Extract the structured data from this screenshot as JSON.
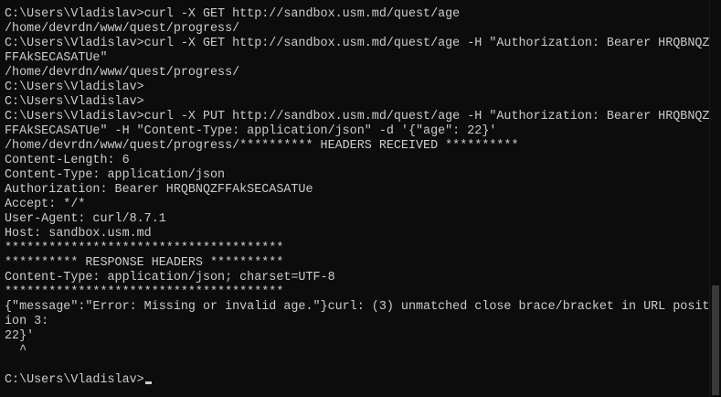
{
  "console": {
    "lines": [
      "C:\\Users\\Vladislav>curl -X GET http://sandbox.usm.md/quest/age",
      "/home/devrdn/www/quest/progress/",
      "C:\\Users\\Vladislav>curl -X GET http://sandbox.usm.md/quest/age -H \"Authorization: Bearer HRQBNQZ",
      "FFAkSECASATUe\"",
      "/home/devrdn/www/quest/progress/",
      "C:\\Users\\Vladislav>",
      "C:\\Users\\Vladislav>",
      "C:\\Users\\Vladislav>curl -X PUT http://sandbox.usm.md/quest/age -H \"Authorization: Bearer HRQBNQZ",
      "FFAkSECASATUe\" -H \"Content-Type: application/json\" -d '{\"age\": 22}'",
      "/home/devrdn/www/quest/progress/********** HEADERS RECEIVED **********",
      "Content-Length: 6",
      "Content-Type: application/json",
      "Authorization: Bearer HRQBNQZFFAkSECASATUe",
      "Accept: */*",
      "User-Agent: curl/8.7.1",
      "Host: sandbox.usm.md",
      "**************************************",
      "********** RESPONSE HEADERS **********",
      "Content-Type: application/json; charset=UTF-8",
      "**************************************",
      "{\"message\":\"Error: Missing or invalid age.\"}curl: (3) unmatched close brace/bracket in URL posit",
      "ion 3:",
      "22}'",
      "  ^",
      "",
      "C:\\Users\\Vladislav>"
    ]
  },
  "colors": {
    "background": "#0c0c0c",
    "text": "#cccccc"
  }
}
